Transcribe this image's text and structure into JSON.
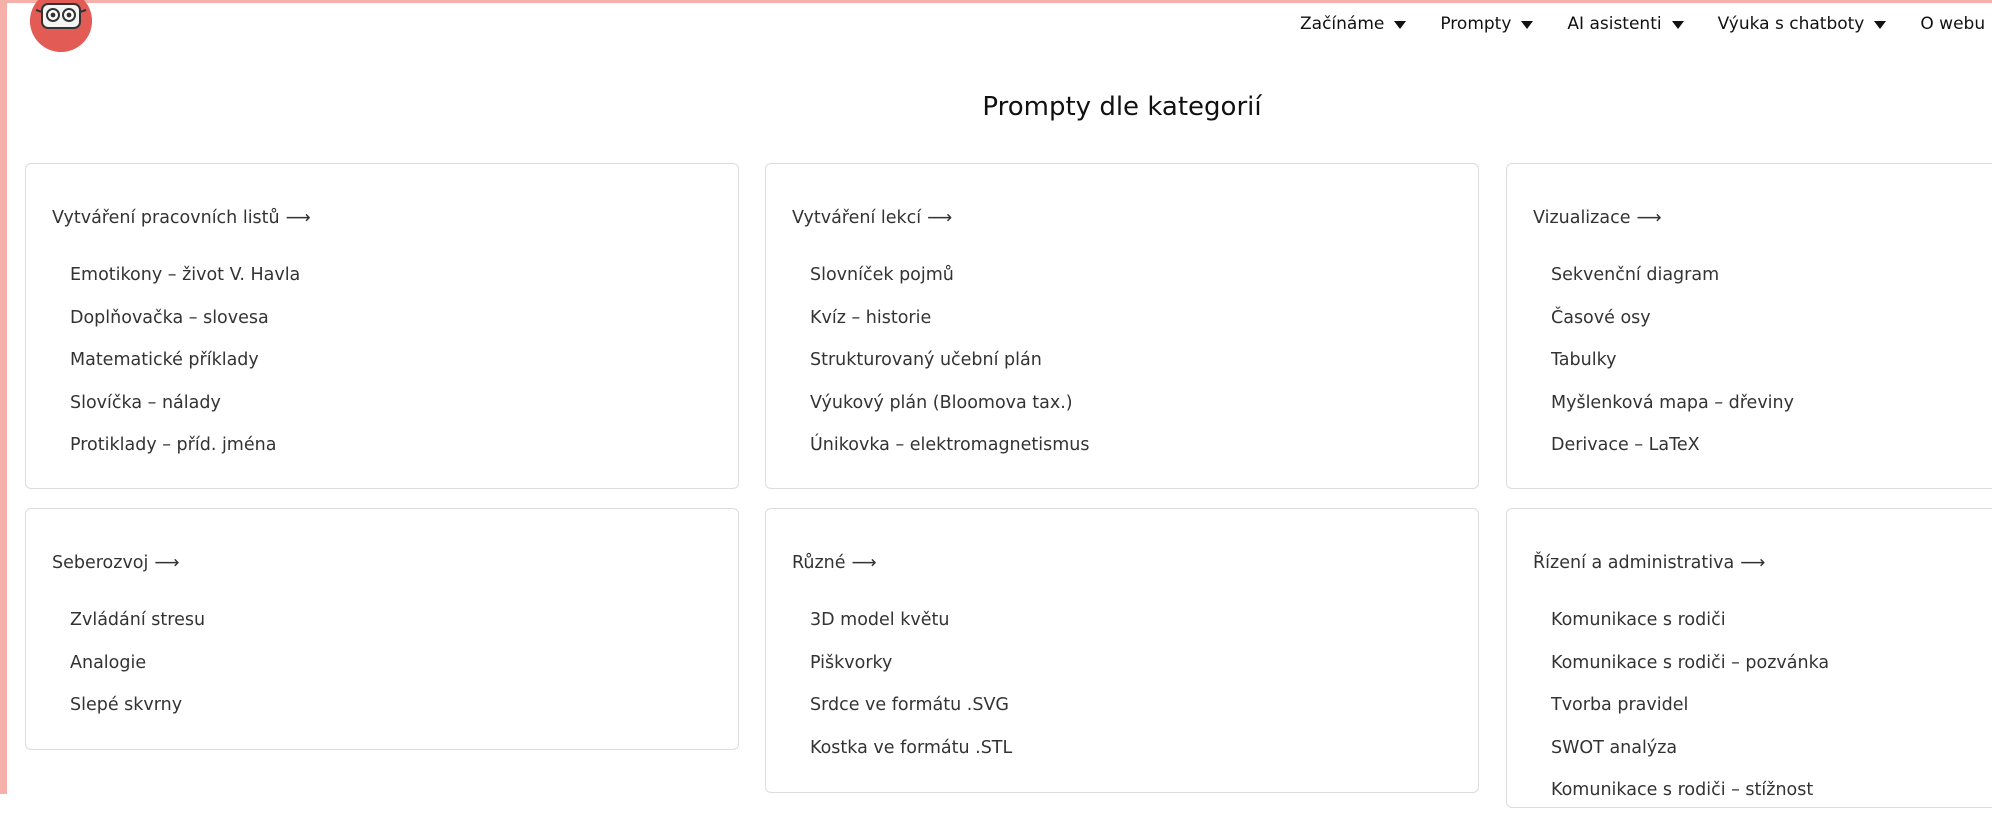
{
  "nav": {
    "items": [
      {
        "label": "Začínáme"
      },
      {
        "label": "Prompty"
      },
      {
        "label": "AI asistenti"
      },
      {
        "label": "Výuka s chatboty"
      },
      {
        "label": "O webu"
      }
    ]
  },
  "page": {
    "title": "Prompty dle kategorií"
  },
  "categories": [
    {
      "title": "Vytváření pracovních listů",
      "arrow": "⟶",
      "items": [
        "Emotikony – život V. Havla",
        "Doplňovačka – slovesa",
        "Matematické příklady",
        "Slovíčka – nálady",
        "Protiklady – příd. jména"
      ]
    },
    {
      "title": "Vytváření lekcí",
      "arrow": "⟶",
      "items": [
        "Slovníček pojmů",
        "Kvíz – historie",
        "Strukturovaný učební plán",
        "Výukový plán (Bloomova tax.)",
        "Únikovka – elektromagnetismus"
      ]
    },
    {
      "title": "Vizualizace",
      "arrow": "⟶",
      "items": [
        "Sekvenční diagram",
        "Časové osy",
        "Tabulky",
        "Myšlenková mapa – dřeviny",
        "Derivace – LaTeX"
      ]
    },
    {
      "title": "Seberozvoj",
      "arrow": "⟶",
      "items": [
        "Zvládání stresu",
        "Analogie",
        "Slepé skvrny"
      ]
    },
    {
      "title": "Různé",
      "arrow": "⟶",
      "items": [
        "3D model květu",
        "Piškvorky",
        "Srdce ve formátu .SVG",
        "Kostka ve formátu .STL"
      ]
    },
    {
      "title": "Řízení a administrativa",
      "arrow": "⟶",
      "items": [
        "Komunikace s rodiči",
        "Komunikace s rodiči – pozvánka",
        "Tvorba pravidel",
        "SWOT analýza",
        "Komunikace s rodiči – stížnost"
      ]
    }
  ],
  "colors": {
    "accent_frame": "#f6b0aa",
    "logo_red": "#e25b55"
  },
  "icons": {
    "logo": "robot-face-logo",
    "nav_caret": "caret-down-icon"
  }
}
